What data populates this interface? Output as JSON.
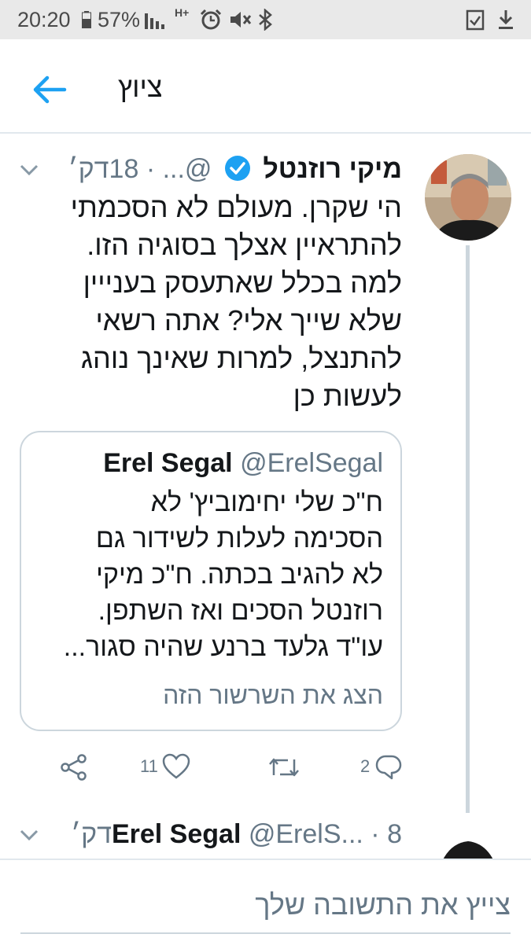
{
  "status_bar": {
    "time": "20:20",
    "battery": "57%",
    "network": "H+",
    "icons": [
      "battery-icon",
      "signal-icon",
      "alarm-icon",
      "mute-icon",
      "bluetooth-icon",
      "task-icon",
      "download-icon"
    ]
  },
  "header": {
    "title": "ציוץ",
    "back_icon": "arrow-left-icon",
    "accent_color": "#1da1f2"
  },
  "tweet": {
    "author_name": "מיקי רוזנטל",
    "handle": "@...",
    "time": "18דק׳",
    "verified": true,
    "text_lines": [
      "הי שקרן. מעולם לא הסכמתי",
      "להתראיין אצלך בסוגיה הזו.",
      "למה בכלל שאתעסק בענייין",
      "שלא שייך אלי? אתה רשאי",
      "להתנצל, למרות שאינך נוהג",
      "לעשות כן"
    ],
    "quote": {
      "name": "Erel Segal",
      "handle": "@ErelSegal",
      "text_lines": [
        "ח\"כ שלי יחימוביץ' לא",
        "הסכימה לעלות לשידור גם",
        "לא להגיב בכתה. ח\"כ מיקי",
        "רוזנטל הסכים ואז השתפן.",
        "עו\"ד גלעד ברנע שהיה סגור..."
      ],
      "show_thread": "הצג את השרשור הזה"
    },
    "actions": {
      "reply_count": "2",
      "like_count": "11"
    }
  },
  "next_tweet": {
    "name": "Erel Segal",
    "handle": "@ErelS...",
    "time": "8דק׳"
  },
  "reply": {
    "placeholder": "צייץ את התשובה שלך"
  },
  "colors": {
    "text": "#14171a",
    "secondary": "#657786",
    "divider": "#e1e8ed",
    "line": "#ccd6dd",
    "status_bg": "#e9e9e9"
  }
}
